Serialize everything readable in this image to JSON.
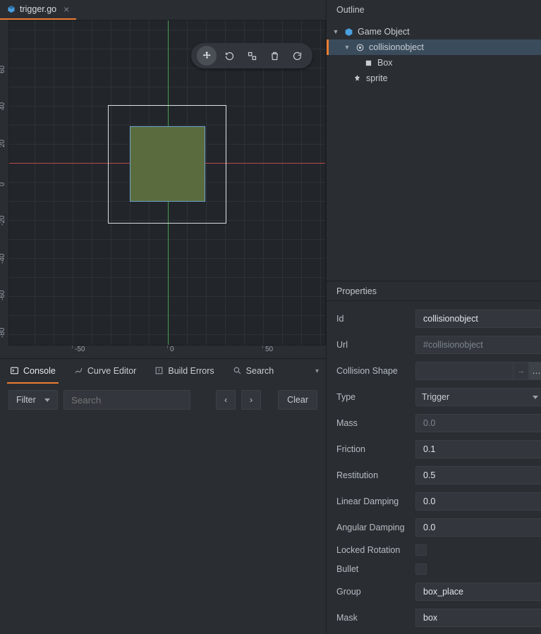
{
  "file_tab": {
    "title": "trigger.go"
  },
  "ruler_y": [
    "60",
    "40",
    "20",
    "0",
    "-20",
    "-40",
    "-60",
    "-80"
  ],
  "ruler_x": [
    "-50",
    "0",
    "50"
  ],
  "bottom_tabs": {
    "console": "Console",
    "curve": "Curve Editor",
    "build": "Build Errors",
    "search": "Search"
  },
  "console": {
    "filter_label": "Filter",
    "search_placeholder": "Search",
    "clear_label": "Clear"
  },
  "outline": {
    "title": "Outline",
    "items": {
      "root": "Game Object",
      "collision": "collisionobject",
      "box": "Box",
      "sprite": "sprite"
    }
  },
  "properties": {
    "title": "Properties",
    "labels": {
      "id": "Id",
      "url": "Url",
      "shape": "Collision Shape",
      "type": "Type",
      "mass": "Mass",
      "friction": "Friction",
      "restitution": "Restitution",
      "linear_damping": "Linear Damping",
      "angular_damping": "Angular Damping",
      "locked_rotation": "Locked Rotation",
      "bullet": "Bullet",
      "group": "Group",
      "mask": "Mask"
    },
    "values": {
      "id": "collisionobject",
      "url": "#collisionobject",
      "shape": "",
      "type": "Trigger",
      "mass": "0.0",
      "friction": "0.1",
      "restitution": "0.5",
      "linear_damping": "0.0",
      "angular_damping": "0.0",
      "group": "box_place",
      "mask": "box"
    }
  }
}
